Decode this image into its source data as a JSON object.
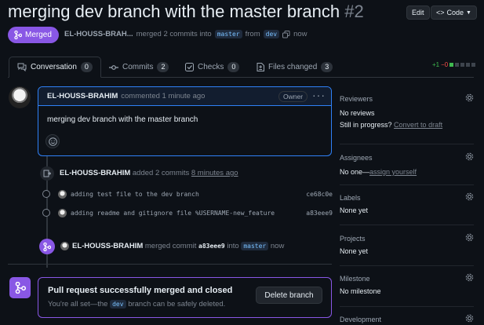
{
  "header": {
    "title": "merging dev branch with the master branch",
    "number": "#2",
    "edit_label": "Edit",
    "code_label": "Code"
  },
  "status": {
    "badge": "Merged",
    "author": "EL-HOUSS-BRAH...",
    "merged_text": "merged 2 commits into",
    "base_branch": "master",
    "from_text": "from",
    "head_branch": "dev",
    "time": "now"
  },
  "tabs": [
    {
      "label": "Conversation",
      "count": "0",
      "icon": "conversation-icon"
    },
    {
      "label": "Commits",
      "count": "2",
      "icon": "commit-icon"
    },
    {
      "label": "Checks",
      "count": "0",
      "icon": "checks-icon"
    },
    {
      "label": "Files changed",
      "count": "3",
      "icon": "file-diff-icon"
    }
  ],
  "diffstat": {
    "additions": "+1",
    "deletions": "−0"
  },
  "comment": {
    "author": "EL-HOUSS-BRAHIM",
    "action": "commented",
    "time": "1 minute ago",
    "role": "Owner",
    "body": "merging dev branch with the master branch"
  },
  "timeline": {
    "commits_event": {
      "author": "EL-HOUSS-BRAHIM",
      "text": "added 2 commits",
      "time": "8 minutes ago"
    },
    "commits": [
      {
        "message": "adding test file to the dev branch",
        "sha": "ce68c0e"
      },
      {
        "message": "adding readme and gitignore file %USERNAME-new_feature",
        "sha": "a83eee9"
      }
    ],
    "merge_event": {
      "author": "EL-HOUSS-BRAHIM",
      "text": "merged commit",
      "sha": "a83eee9",
      "into": "into",
      "branch": "master",
      "time": "now"
    }
  },
  "merge_box": {
    "title": "Pull request successfully merged and closed",
    "sub_prefix": "You're all set—the",
    "branch": "dev",
    "sub_suffix": "branch can be safely deleted.",
    "delete_label": "Delete branch"
  },
  "sidebar": {
    "reviewers": {
      "heading": "Reviewers",
      "value": "No reviews",
      "progress": "Still in progress?",
      "link": "Convert to draft"
    },
    "assignees": {
      "heading": "Assignees",
      "value": "No one—",
      "link": "assign yourself"
    },
    "labels": {
      "heading": "Labels",
      "value": "None yet"
    },
    "projects": {
      "heading": "Projects",
      "value": "None yet"
    },
    "milestone": {
      "heading": "Milestone",
      "value": "No milestone"
    },
    "development": {
      "heading": "Development"
    }
  },
  "colors": {
    "merged": "#8957e5",
    "accent": "#2f81f7",
    "background": "#0d1117"
  }
}
